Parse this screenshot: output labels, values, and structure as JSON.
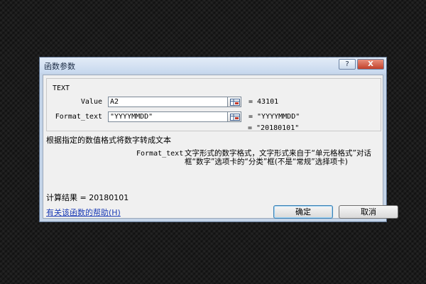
{
  "dialog": {
    "title": "函数参数",
    "help_btn": "?",
    "close_btn": "X"
  },
  "function": {
    "name": "TEXT",
    "args": [
      {
        "label": "Value",
        "input": "A2",
        "result": "= 43101"
      },
      {
        "label": "Format_text",
        "input": "\"YYYYMMDD\"",
        "result": "= \"YYYYMMDD\""
      }
    ],
    "overall_result": "= \"20180101\""
  },
  "description": "根据指定的数值格式将数字转成文本",
  "arg_description": {
    "label": "Format_text",
    "text": "文字形式的数字格式，文字形式来自于“单元格格式”对话框“数字”选项卡的“分类”框(不是“常规”选择项卡)"
  },
  "calc_result": "计算结果 =  20180101",
  "help_link": "有关该函数的帮助(H)",
  "buttons": {
    "ok": "确定",
    "cancel": "取消"
  }
}
